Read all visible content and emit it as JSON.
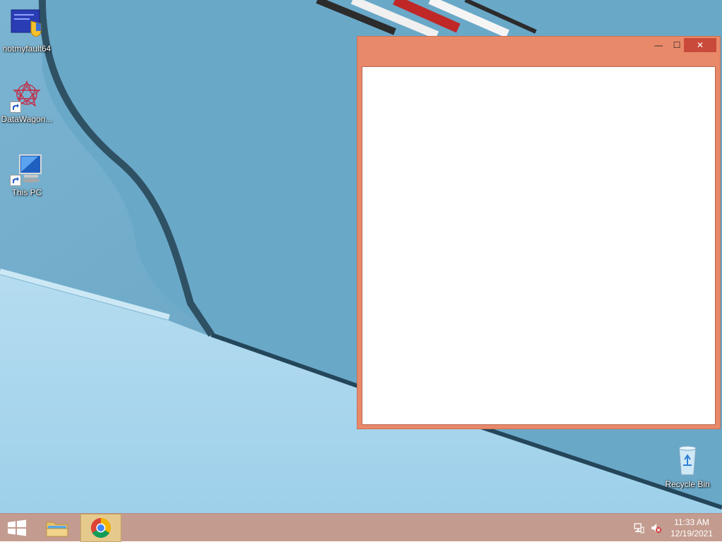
{
  "desktop": {
    "icons": [
      {
        "label": "notmyfault64",
        "icon": "notmyfault-app-icon"
      },
      {
        "label": "DataWagon...",
        "icon": "datawagon-shortcut-icon"
      },
      {
        "label": "This PC",
        "icon": "this-pc-icon"
      },
      {
        "label": "Recycle Bin",
        "icon": "recycle-bin-icon"
      }
    ]
  },
  "window": {
    "controls": {
      "minimize": "—",
      "maximize": "☐",
      "close": "✕"
    },
    "accent": "#e8896a"
  },
  "taskbar": {
    "apps": [
      {
        "name": "start-button",
        "icon": "windows-logo-icon"
      },
      {
        "name": "file-explorer",
        "icon": "folder-icon"
      },
      {
        "name": "chrome",
        "icon": "chrome-icon",
        "active": true
      }
    ],
    "tray": {
      "network": "network-icon",
      "volume": "volume-muted-icon"
    },
    "clock": {
      "time": "11:33 AM",
      "date": "12/19/2021"
    }
  }
}
